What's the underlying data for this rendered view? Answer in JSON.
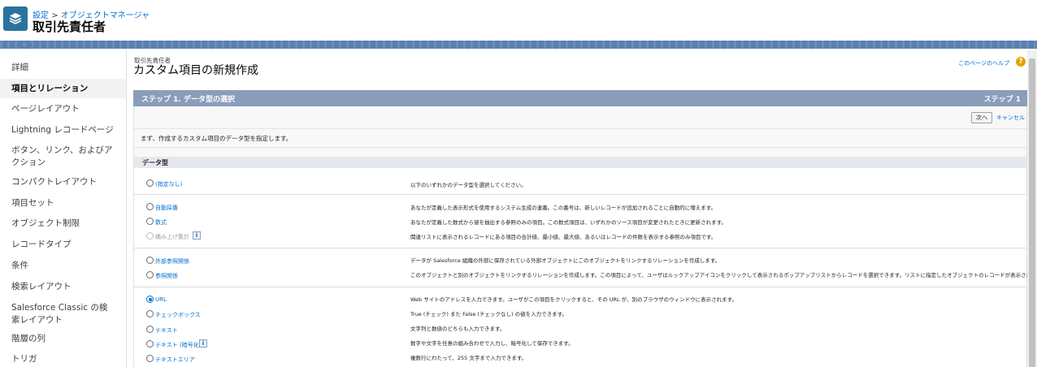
{
  "header": {
    "breadcrumb_parent": "設定",
    "breadcrumb_sep": ">",
    "breadcrumb_current": "オブジェクトマネージャ",
    "object_title": "取引先責任者",
    "icon": "layers-icon"
  },
  "sidebar": {
    "items": [
      {
        "label": "詳細",
        "active": false
      },
      {
        "label": "項目とリレーション",
        "active": true
      },
      {
        "label": "ページレイアウト",
        "active": false
      },
      {
        "label": "Lightning レコードページ",
        "active": false
      },
      {
        "label": "ボタン、リンク、およびアクション",
        "active": false
      },
      {
        "label": "コンパクトレイアウト",
        "active": false
      },
      {
        "label": "項目セット",
        "active": false
      },
      {
        "label": "オブジェクト制限",
        "active": false
      },
      {
        "label": "レコードタイプ",
        "active": false
      },
      {
        "label": "条件",
        "active": false
      },
      {
        "label": "検索レイアウト",
        "active": false
      },
      {
        "label": "Salesforce Classic の検索レイアウト",
        "active": false
      },
      {
        "label": "階層の列",
        "active": false
      },
      {
        "label": "トリガ",
        "active": false
      }
    ]
  },
  "main": {
    "sub_title": "取引先責任者",
    "title": "カスタム項目の新規作成",
    "help_link": "このページのヘルプ",
    "help_icon": "?",
    "step_title": "ステップ 1. データ型の選択",
    "step_label": "ステップ 1",
    "next_button": "次へ",
    "cancel_link": "キャンセル",
    "instruction": "まず、作成するカスタム項目のデータ型を指定します。",
    "section_label": "データ型"
  },
  "options": {
    "none": {
      "label": "(指定なし)",
      "desc": "以下のいずれかのデータ型を選択してください。"
    },
    "autonum": {
      "label": "自動採番",
      "desc": "あなたが定義した表示形式を使用するシステム生成の連番。この番号は、新しいレコードが追加されるごとに自動的に増えます。"
    },
    "formula": {
      "label": "数式",
      "desc": "あなたが定義した数式から値を抽出する参照のみの項目。この数式項目は、いずれかのソース項目が変更されたときに更新されます。"
    },
    "rollup": {
      "label": "積み上げ集計",
      "desc": "関連リストに表示されるレコードにある項目の合計値、最小値、最大値、あるいはレコードの件数を表示する参照のみ項目です。"
    },
    "external": {
      "label": "外部参照関係",
      "desc": "データが Salesforce 組織の外部に保存されている外部オブジェクトにこのオブジェクトをリンクするリレーションを作成します。"
    },
    "lookup": {
      "label": "参照関係",
      "desc": "このオブジェクトと別のオブジェクトをリンクするリレーションを作成します。この項目によって、ユーザはルックアップアイコンをクリックして表示されるポップアップリストからレコードを選択できます。リストに指定したオブジェクトのレコードが表示されます。"
    },
    "url": {
      "label": "URL",
      "desc": "Web サイトのアドレスを入力できます。ユーザがこの項目をクリックすると、その URL が、別のブラウザのウィンドウに表示されます。"
    },
    "checkbox": {
      "label": "チェックボックス",
      "desc": "True (チェック) また False (チェックなし) の値を入力できます。"
    },
    "text": {
      "label": "テキスト",
      "desc": "文字列と数値のどちらも入力できます。"
    },
    "encrypted": {
      "label": "テキスト (暗号化)",
      "desc": "数字や文字を任意の組み合わせで入力し、暗号化して保存できます。"
    },
    "textarea": {
      "label": "テキストエリア",
      "desc": "複数行にわたって、255 文字まで入力できます。"
    },
    "info_icon": "i"
  },
  "colors": {
    "link": "#0070d2",
    "step_bar": "#8a9dbb",
    "header_icon": "#2a739e",
    "band": "#5a7fb0"
  }
}
